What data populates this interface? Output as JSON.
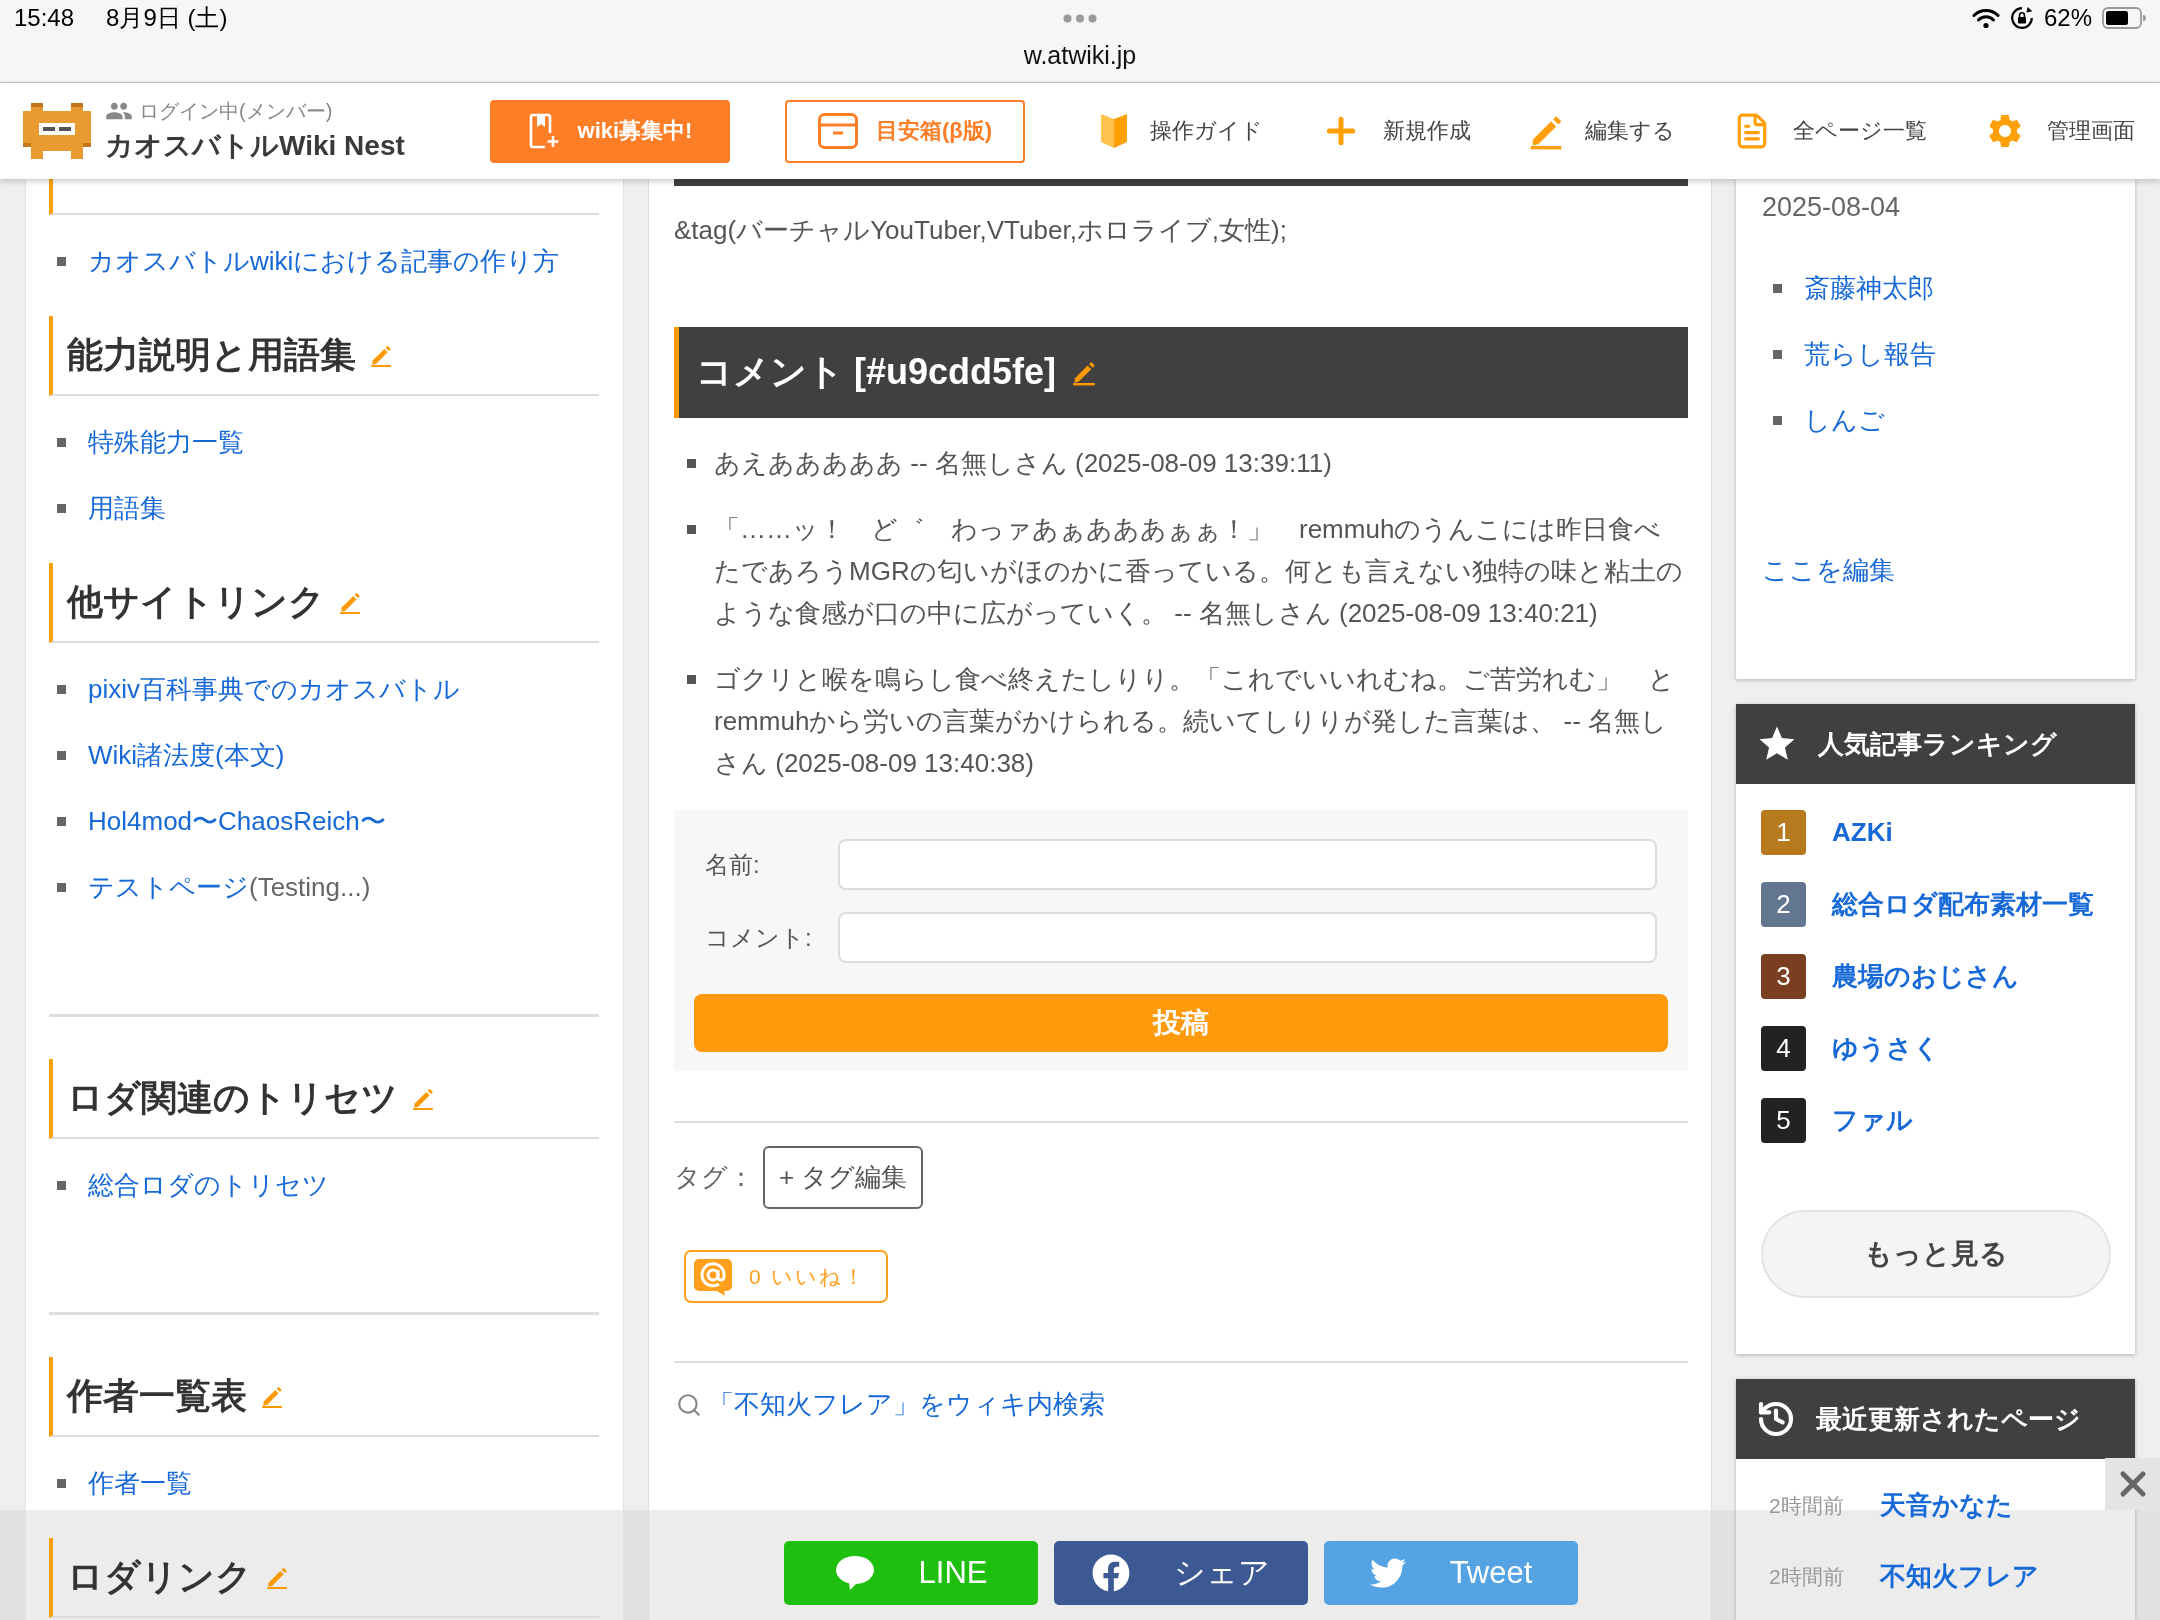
{
  "status_bar": {
    "time": "15:48",
    "date": "8月9日 (土)",
    "battery": "62%"
  },
  "browser": {
    "url": "w.atwiki.jp"
  },
  "header": {
    "login_status": "ログイン中(メンバー)",
    "site_title": "カオスバトルWiki Nest",
    "recruit_button": "wiki募集中!",
    "suggestion_button": "目安箱(β版)",
    "nav": [
      {
        "kind": "guide",
        "label": "操作ガイド"
      },
      {
        "kind": "new",
        "label": "新規作成"
      },
      {
        "kind": "edit",
        "label": "編集する"
      },
      {
        "kind": "pages",
        "label": "全ページ一覧"
      },
      {
        "kind": "admin",
        "label": "管理画面"
      }
    ]
  },
  "left_sidebar": {
    "blocks": [
      {
        "sections": [
          {
            "links": [
              {
                "text": "カオスバトルwikiにおける記事の作り方"
              }
            ]
          },
          {
            "title": "能力説明と用語集",
            "links": [
              {
                "text": "特殊能力一覧"
              },
              {
                "text": "用語集"
              }
            ]
          },
          {
            "title": "他サイトリンク",
            "links": [
              {
                "text": "pixiv百科事典でのカオスバトル"
              },
              {
                "text": "Wiki諸法度(本文)"
              },
              {
                "text": "Hol4mod〜ChaosReich〜"
              },
              {
                "text": "テストページ",
                "note": "(Testing...)"
              }
            ]
          }
        ]
      },
      {
        "sections": [
          {
            "title": "ロダ関連のトリセツ",
            "links": [
              {
                "text": "総合ロダのトリセツ"
              }
            ]
          }
        ]
      },
      {
        "sections": [
          {
            "title": "作者一覧表",
            "links": [
              {
                "text": "作者一覧"
              }
            ]
          },
          {
            "title": "ロダリンク"
          }
        ]
      }
    ]
  },
  "main": {
    "tag_line": "&tag(バーチャルYouTuber,VTuber,ホロライブ,女性);",
    "comment_section": {
      "title": "コメント [#u9cdd5fe]",
      "comments": [
        "あえあああああ -- 名無しさん (2025-08-09 13:39:11)",
        "「……ッ！　ど゛　わっァあぁあああぁぁ！」　remmuhのうんこには昨日食べたであろうMGRの匂いがほのかに香っている。何とも言えない独特の味と粘土のような食感が口の中に広がっていく。 -- 名無しさん (2025-08-09 13:40:21)",
        "ゴクリと喉を鳴らし食べ終えたしりり。「これでいいれむね。ご苦労れむ」　とremmuhから労いの言葉がかけられる。続いてしりりが発した言葉は、 -- 名無しさん (2025-08-09 13:40:38)"
      ],
      "form": {
        "name_label": "名前:",
        "comment_label": "コメント:",
        "submit": "投稿"
      }
    },
    "tags": {
      "label": "タグ：",
      "edit_button": "+ タグ編集"
    },
    "like_button": {
      "count": "0",
      "label": "いいね！"
    },
    "search_link": "「不知火フレア」をウィキ内検索"
  },
  "share_bar": {
    "buttons": [
      {
        "kind": "line",
        "label": "LINE"
      },
      {
        "kind": "facebook",
        "label": "シェア"
      },
      {
        "kind": "twitter",
        "label": "Tweet"
      }
    ]
  },
  "right_sidebar": {
    "info_card": {
      "date": "2025-08-04",
      "links": [
        "斎藤神太郎",
        "荒らし報告",
        "しんご"
      ],
      "edit_link": "ここを編集"
    },
    "ranking": {
      "title": "人気記事ランキング",
      "items": [
        {
          "rank": "1",
          "title": "AZKi",
          "color": "#b87a1f"
        },
        {
          "rank": "2",
          "title": "総合ロダ配布素材一覧",
          "color": "#62778f"
        },
        {
          "rank": "3",
          "title": "農場のおじさん",
          "color": "#7a3e22"
        },
        {
          "rank": "4",
          "title": "ゆうさく",
          "color": "#222222"
        },
        {
          "rank": "5",
          "title": "ファル",
          "color": "#222222"
        }
      ],
      "more_button": "もっと見る"
    },
    "recent": {
      "title": "最近更新されたページ",
      "items": [
        {
          "time": "2時間前",
          "title": "天音かなた"
        },
        {
          "time": "2時間前",
          "title": "不知火フレア"
        }
      ]
    }
  }
}
